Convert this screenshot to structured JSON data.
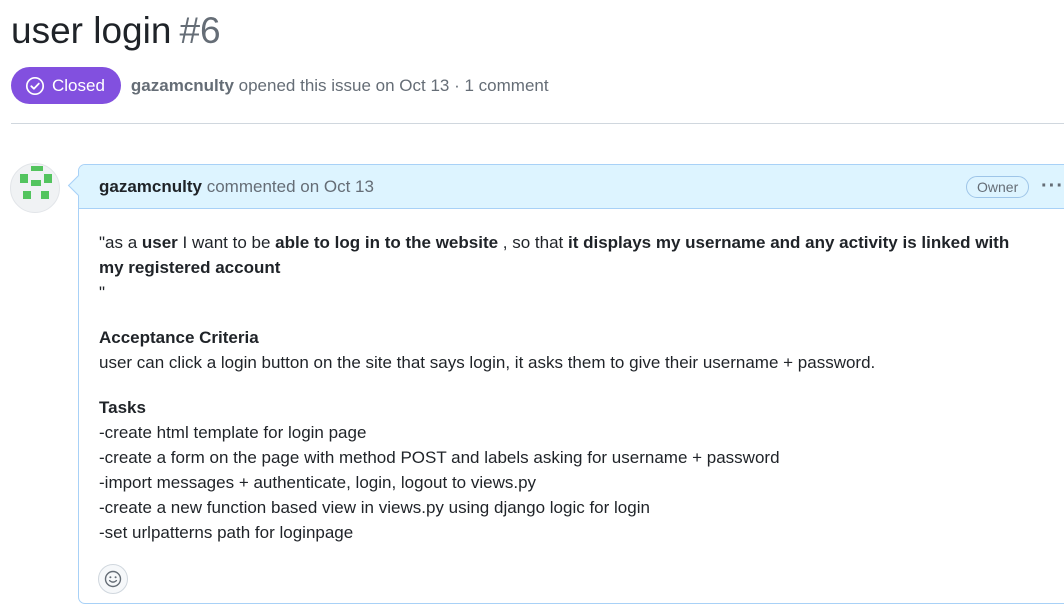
{
  "issue": {
    "title": "user login",
    "number": "#6",
    "state": "Closed",
    "author": "gazamcnulty",
    "opened_text": "opened this issue on Oct 13 · 1 comment"
  },
  "comment": {
    "author": "gazamcnulty",
    "meta": "commented on Oct 13",
    "role_badge": "Owner",
    "more_label": "···",
    "story": {
      "p1": "\"as a ",
      "b1": "user",
      "p2": " I want to be ",
      "b2": "able to log in to the website",
      "p3": " , so that ",
      "b3": "it displays my username and any activity is linked with my registered account",
      "end_quote": "\""
    },
    "acceptance_heading": "Acceptance Criteria",
    "acceptance_text": "user can click a login button on the site that says login, it asks them to give their username + password.",
    "tasks_heading": "Tasks",
    "tasks": [
      "-create html template for login page",
      "-create a form on the page with method POST and labels asking for username + password",
      "-import messages + authenticate, login, logout to views.py",
      "-create a new function based view in views.py using django logic for login",
      "-set urlpatterns path for loginpage"
    ]
  },
  "colors": {
    "closed_badge": "#8250df",
    "comment_header_bg": "#ddf4ff",
    "comment_border": "#a8d1f7",
    "avatar_green": "#53c45e"
  },
  "icons": {
    "state": "check-circle-icon",
    "more": "kebab-horizontal-icon",
    "reaction": "smiley-icon"
  }
}
